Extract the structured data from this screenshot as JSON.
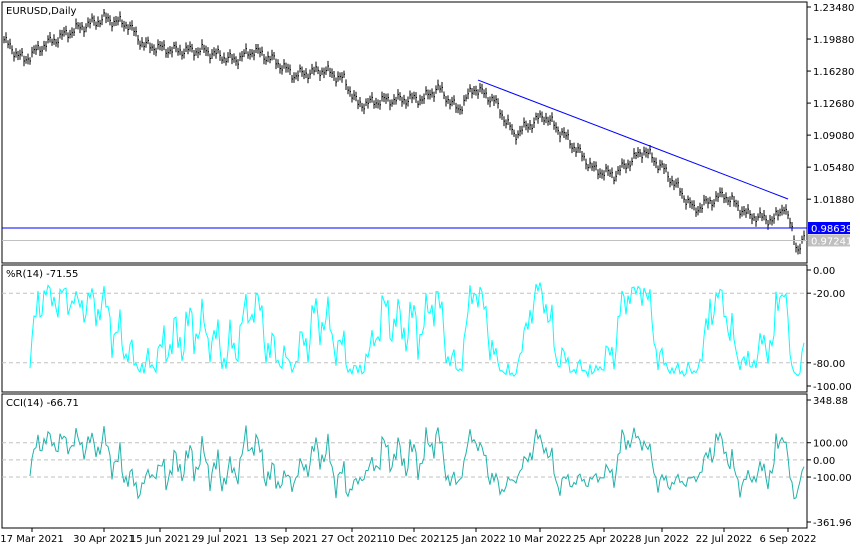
{
  "chart_data": [
    {
      "type": "bar",
      "title": "EURUSD,Daily",
      "symbol": "EURUSD",
      "timeframe": "Daily",
      "ylim": [
        0.951,
        1.2405
      ],
      "y_ticks": [
        "1.23480",
        "1.19880",
        "1.16280",
        "1.12680",
        "1.09080",
        "1.05480",
        "1.01880"
      ],
      "price_line": {
        "label": "0.98639",
        "value": 0.98639,
        "color": "#0000ff"
      },
      "last_price": {
        "label": "0.97241",
        "value": 0.97241,
        "color": "#c0c0c0"
      },
      "trendline": {
        "from": [
          237,
          1.1527
        ],
        "to": [
          392,
          1.019
        ],
        "color": "#0000ff"
      },
      "anchors": [
        [
          0,
          1.198
        ],
        [
          2,
          1.192
        ],
        [
          10,
          1.175
        ],
        [
          20,
          1.192
        ],
        [
          35,
          1.209
        ],
        [
          50,
          1.222
        ],
        [
          62,
          1.215
        ],
        [
          70,
          1.192
        ],
        [
          85,
          1.186
        ],
        [
          100,
          1.186
        ],
        [
          115,
          1.175
        ],
        [
          125,
          1.186
        ],
        [
          135,
          1.175
        ],
        [
          145,
          1.158
        ],
        [
          160,
          1.164
        ],
        [
          170,
          1.153
        ],
        [
          177,
          1.125
        ],
        [
          190,
          1.13
        ],
        [
          210,
          1.132
        ],
        [
          217,
          1.144
        ],
        [
          227,
          1.119
        ],
        [
          235,
          1.144
        ],
        [
          245,
          1.13
        ],
        [
          255,
          1.091
        ],
        [
          270,
          1.113
        ],
        [
          280,
          1.091
        ],
        [
          295,
          1.052
        ],
        [
          305,
          1.046
        ],
        [
          320,
          1.074
        ],
        [
          330,
          1.052
        ],
        [
          345,
          1.007
        ],
        [
          360,
          1.024
        ],
        [
          372,
          1.001
        ],
        [
          385,
          0.995
        ],
        [
          390,
          1.012
        ],
        [
          397,
          0.962
        ],
        [
          400,
          0.9724
        ]
      ],
      "x_ticks": [
        {
          "day": 14,
          "label": "17 Mar 2021"
        },
        {
          "day": 50,
          "label": "30 Apr 2021"
        },
        {
          "day": 78,
          "label": "15 Jun 2021"
        },
        {
          "day": 108,
          "label": "29 Jul 2021"
        },
        {
          "day": 141,
          "label": "13 Sep 2021"
        },
        {
          "day": 174,
          "label": "27 Oct 2021"
        },
        {
          "day": 205,
          "label": "10 Dec 2021"
        },
        {
          "day": 236,
          "label": "25 Jan 2022"
        },
        {
          "day": 268,
          "label": "10 Mar 2022"
        },
        {
          "day": 300,
          "label": "25 Apr 2022"
        },
        {
          "day": 329,
          "label": "8 Jun 2022"
        },
        {
          "day": 360,
          "label": "22 Jul 2022"
        },
        {
          "day": 392,
          "label": "6 Sep 2022"
        }
      ],
      "colors": {
        "bars": "#000000"
      }
    },
    {
      "type": "line",
      "title": "%R(14) -71.55",
      "ylim": [
        -100,
        0
      ],
      "y_ticks": [
        "0.00",
        "-20.00",
        "-80.00",
        "-100.00"
      ],
      "levels": [
        -20,
        -80
      ],
      "color": "#00ffff"
    },
    {
      "type": "line",
      "title": "CCI(14) -66.71",
      "ylim": [
        -361.96,
        348.88
      ],
      "y_ticks": [
        "348.88",
        "100.00",
        "0.00",
        "-100.00",
        "-361.96"
      ],
      "levels": [
        100,
        0,
        -100
      ],
      "color": "#20b2aa"
    }
  ]
}
